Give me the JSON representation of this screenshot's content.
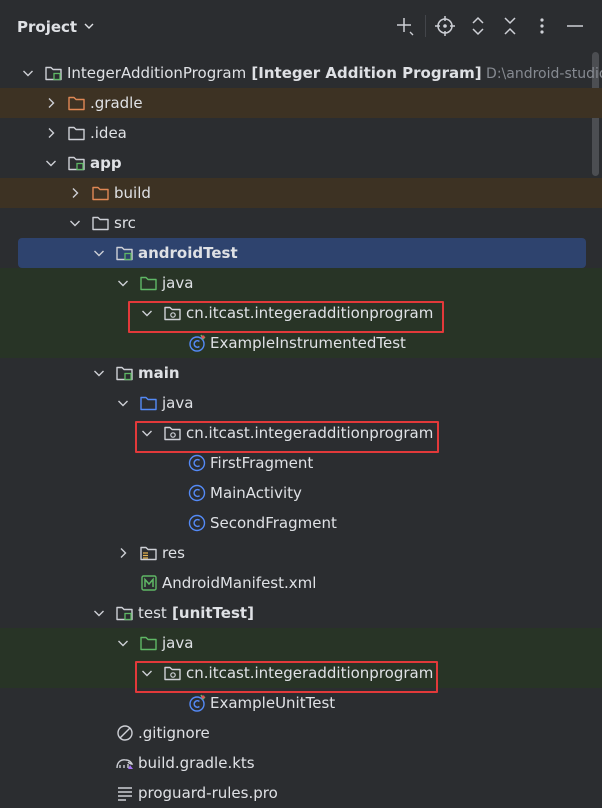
{
  "header": {
    "title": "Project",
    "icons": [
      "add-icon",
      "crosshair-icon",
      "expand-icon",
      "collapse-icon",
      "more-icon",
      "minimize-icon"
    ]
  },
  "tree": [
    {
      "label": "IntegerAdditionProgram",
      "extra": "[Integer Addition Program]",
      "path": "D:\\android-studio-",
      "icon": "module-folder",
      "expanded": true
    },
    {
      "label": ".gradle",
      "icon": "folder-excluded",
      "expanded": false
    },
    {
      "label": ".idea",
      "icon": "folder",
      "expanded": false
    },
    {
      "label": "app",
      "icon": "module-folder",
      "expanded": true
    },
    {
      "label": "build",
      "icon": "folder-excluded",
      "expanded": false
    },
    {
      "label": "src",
      "icon": "folder",
      "expanded": true
    },
    {
      "label": "androidTest",
      "icon": "source-folder-test",
      "expanded": true,
      "selected": true
    },
    {
      "label": "java",
      "icon": "folder-test",
      "expanded": true
    },
    {
      "label": "cn.itcast.integeradditionprogram",
      "icon": "package",
      "expanded": true,
      "boxed": true
    },
    {
      "label": "ExampleInstrumentedTest",
      "icon": "class-test"
    },
    {
      "label": "main",
      "icon": "source-folder",
      "expanded": true
    },
    {
      "label": "java",
      "icon": "folder-source",
      "expanded": true
    },
    {
      "label": "cn.itcast.integeradditionprogram",
      "icon": "package",
      "expanded": true,
      "boxed": true
    },
    {
      "label": "FirstFragment",
      "icon": "class"
    },
    {
      "label": "MainActivity",
      "icon": "class"
    },
    {
      "label": "SecondFragment",
      "icon": "class"
    },
    {
      "label": "res",
      "icon": "folder-res",
      "expanded": false
    },
    {
      "label": "AndroidManifest.xml",
      "icon": "manifest"
    },
    {
      "label": "test",
      "extra": "[unitTest]",
      "icon": "source-folder",
      "expanded": true
    },
    {
      "label": "java",
      "icon": "folder-test",
      "expanded": true
    },
    {
      "label": "cn.itcast.integeradditionprogram",
      "icon": "package",
      "expanded": true,
      "boxed": true
    },
    {
      "label": "ExampleUnitTest",
      "icon": "class-test"
    },
    {
      "label": ".gitignore",
      "icon": "ignore"
    },
    {
      "label": "build.gradle.kts",
      "icon": "gradle"
    },
    {
      "label": "proguard-rules.pro",
      "icon": "text-file"
    }
  ],
  "colors": {
    "background": "#2b2d30",
    "excluded_row": "#3d3223",
    "test_row": "#283426",
    "selected_row": "#2e436e",
    "highlight_box": "#e2393a"
  }
}
